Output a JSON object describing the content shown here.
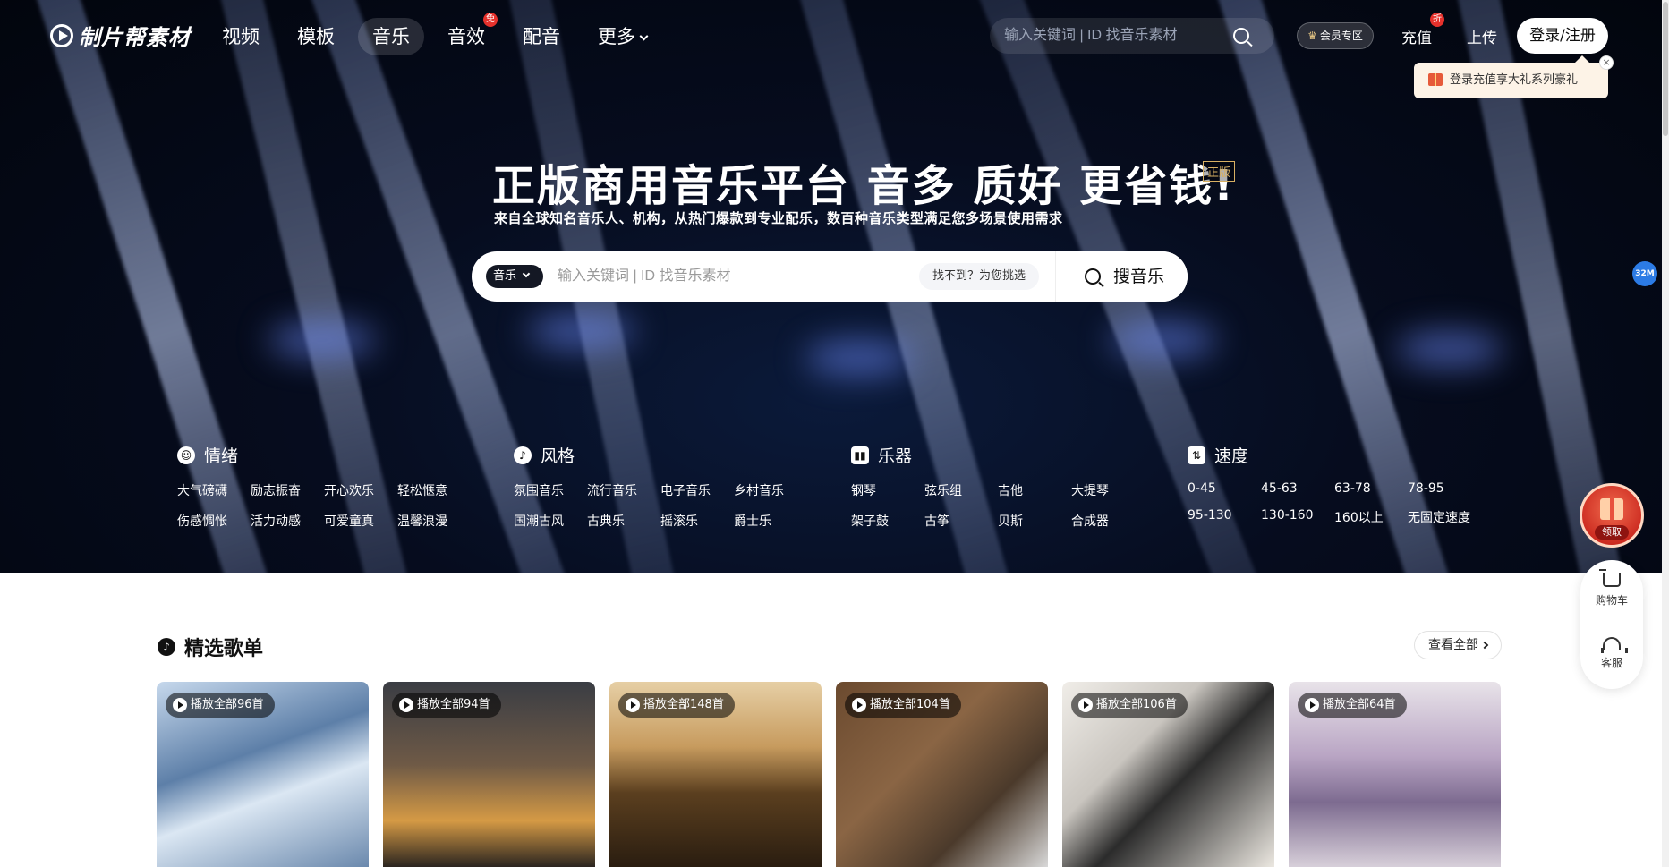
{
  "brand": {
    "logo_text": "制片帮素材"
  },
  "nav": {
    "items": [
      {
        "label": "视频"
      },
      {
        "label": "模板"
      },
      {
        "label": "音乐"
      },
      {
        "label": "音效",
        "badge": "免"
      },
      {
        "label": "配音"
      },
      {
        "label": "更多"
      }
    ],
    "search_placeholder": "输入关键词 | ID 找音乐素材",
    "vip_label": "会员专区",
    "recharge_label": "充值",
    "recharge_badge": "折",
    "upload_label": "上传",
    "login_label": "登录/注册",
    "tip_text": "登录充值享大礼系列豪礼",
    "tip_close": "×"
  },
  "hero": {
    "headline": "正版商用音乐平台 音多 质好 更省钱!",
    "badge": "正版",
    "subline": "来自全球知名音乐人、机构，从热门爆款到专业配乐，数百种音乐类型满足您多场景使用需求",
    "search": {
      "category": "音乐",
      "placeholder": "输入关键词 | ID 找音乐素材",
      "pick_label": "找不到？为您挑选",
      "button_label": "搜音乐"
    }
  },
  "categories": [
    {
      "title": "情绪",
      "icon": "☺",
      "tags": [
        "大气磅礴",
        "励志振奋",
        "开心欢乐",
        "轻松惬意",
        "伤感惆怅",
        "活力动感",
        "可爱童真",
        "温馨浪漫"
      ]
    },
    {
      "title": "风格",
      "icon": "♪",
      "tags": [
        "氛围音乐",
        "流行音乐",
        "电子音乐",
        "乡村音乐",
        "国潮古风",
        "古典乐",
        "摇滚乐",
        "爵士乐"
      ]
    },
    {
      "title": "乐器",
      "icon": "▮▮",
      "tags": [
        "钢琴",
        "弦乐组",
        "吉他",
        "大提琴",
        "架子鼓",
        "古筝",
        "贝斯",
        "合成器"
      ]
    },
    {
      "title": "速度",
      "icon": "⇅",
      "tags": [
        "0-45",
        "45-63",
        "63-78",
        "78-95",
        "95-130",
        "130-160",
        "160以上",
        "无固定速度"
      ]
    }
  ],
  "floating": {
    "storage_badge": "32M",
    "gift_label": "领取",
    "cart_label": "购物车",
    "service_label": "客服"
  },
  "playlists": {
    "title": "精选歌单",
    "view_all": "查看全部",
    "items": [
      {
        "label": "播放全部96首"
      },
      {
        "label": "播放全部94首"
      },
      {
        "label": "播放全部148首"
      },
      {
        "label": "播放全部104首"
      },
      {
        "label": "播放全部106首"
      },
      {
        "label": "播放全部64首"
      }
    ]
  }
}
